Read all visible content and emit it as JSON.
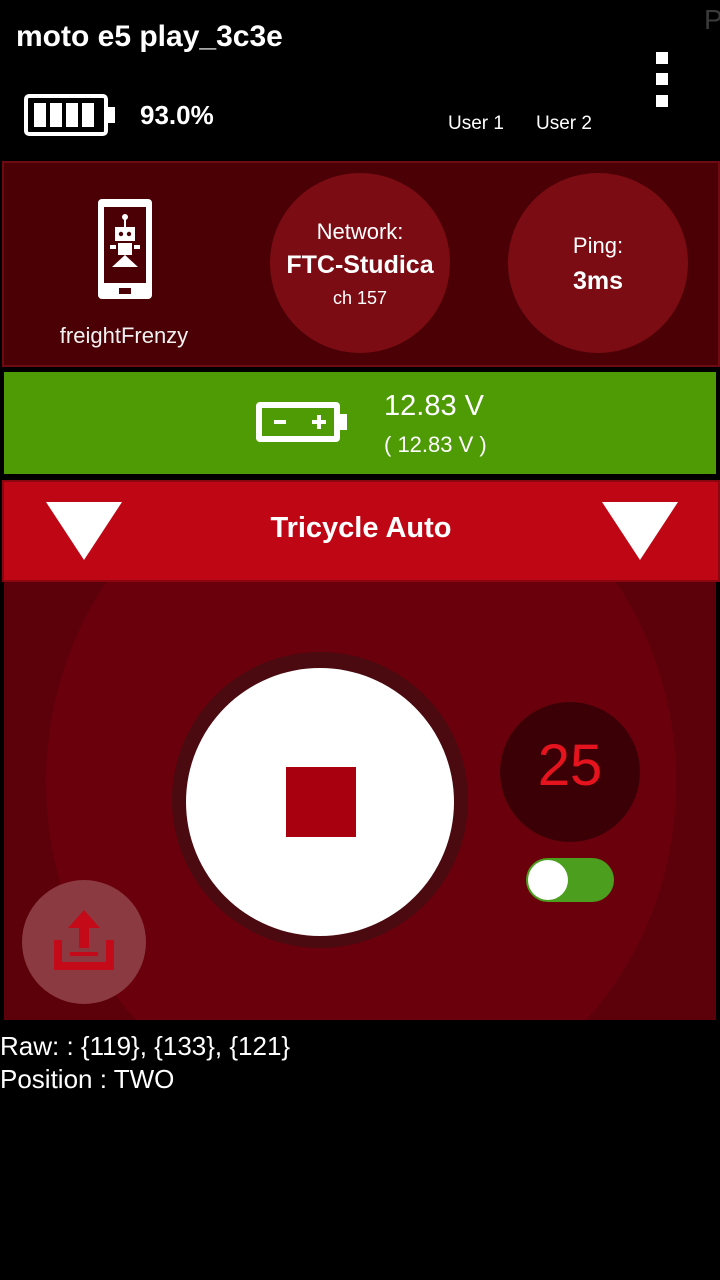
{
  "header": {
    "device_name": "moto e5 play_3c3e",
    "corner_glyph": "P",
    "phone_battery": "93.0%",
    "users": [
      "User 1",
      "User 2"
    ],
    "icons": [
      "battery-icon",
      "more-vert-icon"
    ]
  },
  "robot": {
    "name": "freightFrenzy",
    "network_label": "Network:",
    "network_name": "FTC-Studica",
    "channel": "ch 157",
    "ping_label": "Ping:",
    "ping_value": "3ms",
    "icon": "robot-controller-phone-icon"
  },
  "robot_battery": {
    "voltage": "12.83 V",
    "voltage_min": "( 12.83 V )",
    "color": "#4e9b06",
    "icon": "robot-battery-icon"
  },
  "opmode": {
    "name": "Tricycle Auto",
    "color": "#bf0615",
    "icons": [
      "dropdown-triangle-left-icon",
      "dropdown-triangle-right-icon"
    ]
  },
  "controls": {
    "timer_value": "25",
    "timer_enabled": true,
    "icons": [
      "stop-icon",
      "upload-icon"
    ]
  },
  "telemetry": [
    "Raw: : {119}, {133}, {121}",
    "Position : TWO"
  ]
}
